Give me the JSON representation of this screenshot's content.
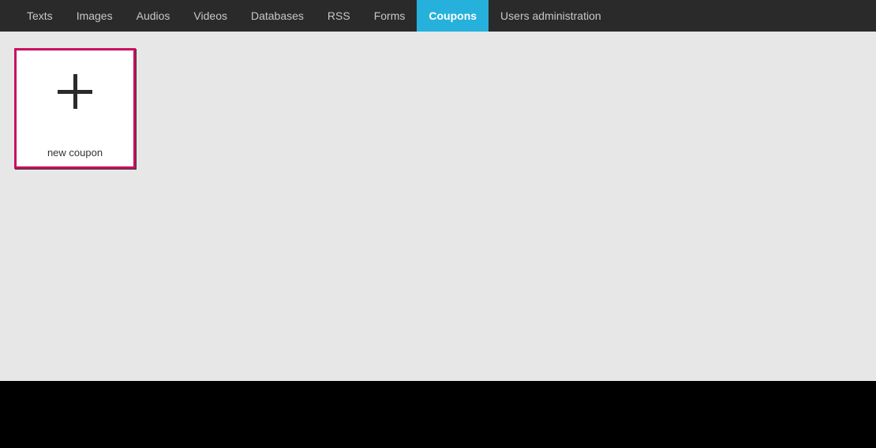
{
  "nav": {
    "tabs": [
      {
        "label": "Texts",
        "active": false
      },
      {
        "label": "Images",
        "active": false
      },
      {
        "label": "Audios",
        "active": false
      },
      {
        "label": "Videos",
        "active": false
      },
      {
        "label": "Databases",
        "active": false
      },
      {
        "label": "RSS",
        "active": false
      },
      {
        "label": "Forms",
        "active": false
      },
      {
        "label": "Coupons",
        "active": true
      },
      {
        "label": "Users administration",
        "active": false
      }
    ]
  },
  "main": {
    "new_card": {
      "label": "new coupon",
      "icon": "plus-icon"
    }
  },
  "colors": {
    "navbar_bg": "#2a2a2a",
    "active_tab": "#25b1dc",
    "card_border": "#c8105f",
    "content_bg": "#e7e7e7"
  }
}
